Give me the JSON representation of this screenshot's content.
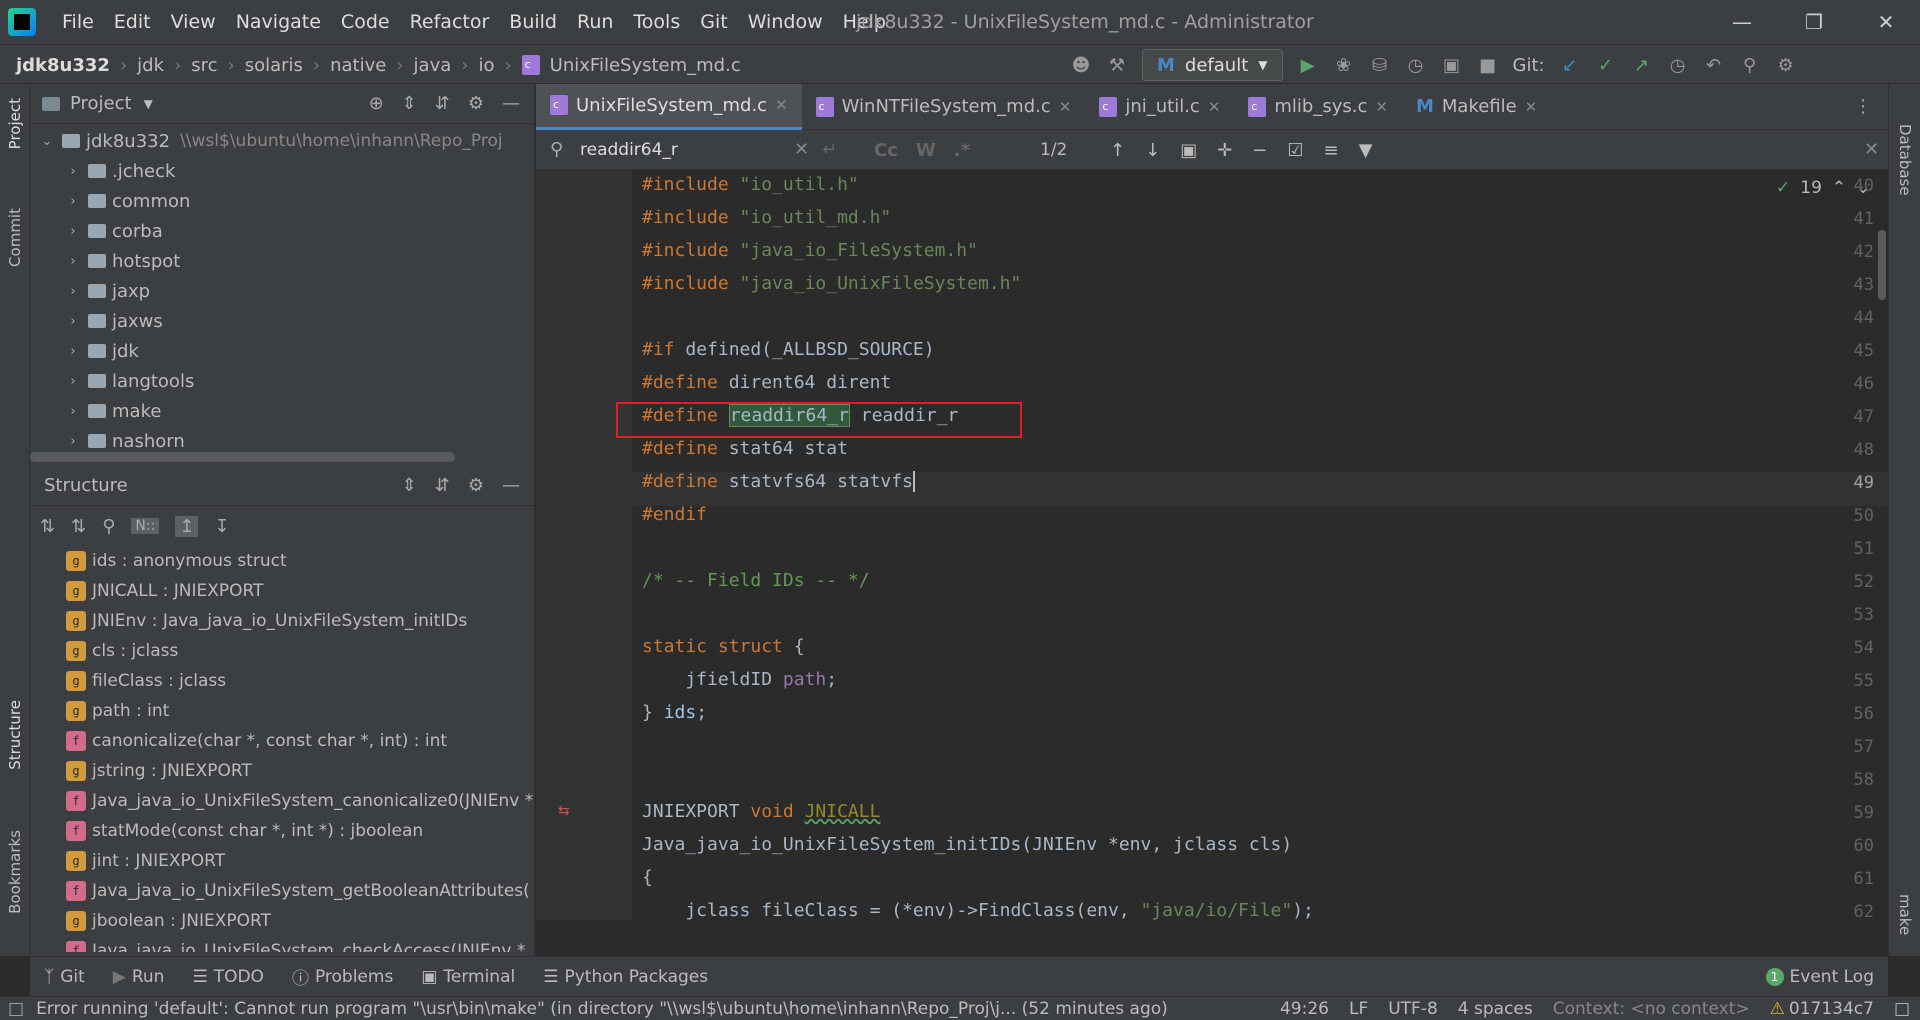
{
  "window": {
    "title": "jdk8u332 - UnixFileSystem_md.c - Administrator"
  },
  "menu": [
    "File",
    "Edit",
    "View",
    "Navigate",
    "Code",
    "Refactor",
    "Build",
    "Run",
    "Tools",
    "Git",
    "Window",
    "Help"
  ],
  "breadcrumb": [
    "jdk8u332",
    "jdk",
    "src",
    "solaris",
    "native",
    "java",
    "io",
    "UnixFileSystem_md.c"
  ],
  "toolbar": {
    "run_config": "default",
    "git_label": "Git:"
  },
  "side_tools": {
    "left": [
      "Project",
      "Commit",
      "Structure",
      "Bookmarks"
    ],
    "right": [
      "Database",
      "make"
    ]
  },
  "project_panel": {
    "title": "Project",
    "root": {
      "name": "jdk8u332",
      "path": "\\\\wsl$\\ubuntu\\home\\inhann\\Repo_Proj"
    },
    "items": [
      ".jcheck",
      "common",
      "corba",
      "hotspot",
      "jaxp",
      "jaxws",
      "jdk",
      "langtools",
      "make",
      "nashorn"
    ]
  },
  "structure_panel": {
    "title": "Structure",
    "items": [
      {
        "kind": "g",
        "label": "ids : anonymous struct"
      },
      {
        "kind": "g",
        "label": "JNICALL : JNIEXPORT"
      },
      {
        "kind": "g",
        "label": "JNIEnv : Java_java_io_UnixFileSystem_initIDs"
      },
      {
        "kind": "g",
        "label": "cls : jclass"
      },
      {
        "kind": "g",
        "label": "fileClass : jclass"
      },
      {
        "kind": "g",
        "label": "path : int"
      },
      {
        "kind": "f",
        "label": "canonicalize(char *, const char *, int) : int"
      },
      {
        "kind": "g",
        "label": "jstring : JNIEXPORT"
      },
      {
        "kind": "f",
        "label": "Java_java_io_UnixFileSystem_canonicalize0(JNIEnv *"
      },
      {
        "kind": "f",
        "label": "statMode(const char *, int *) : jboolean"
      },
      {
        "kind": "g",
        "label": "jint : JNIEXPORT"
      },
      {
        "kind": "f",
        "label": "Java_java_io_UnixFileSystem_getBooleanAttributes("
      },
      {
        "kind": "g",
        "label": "jboolean : JNIEXPORT"
      },
      {
        "kind": "f",
        "label": "Java_java_io_UnixFileSystem_checkAccess(JNIEnv *"
      }
    ]
  },
  "tabs": [
    {
      "label": "UnixFileSystem_md.c",
      "active": true
    },
    {
      "label": "WinNTFileSystem_md.c",
      "active": false
    },
    {
      "label": "jni_util.c",
      "active": false
    },
    {
      "label": "mlib_sys.c",
      "active": false
    },
    {
      "label": "Makefile",
      "active": false
    }
  ],
  "find": {
    "query": "readdir64_r",
    "match_count": "1/2",
    "options": [
      "Cc",
      "W",
      ".*"
    ]
  },
  "editor": {
    "inspection_count": "19",
    "lines": [
      {
        "n": "40",
        "text": "#include \"io_util.h\""
      },
      {
        "n": "41",
        "text": "#include \"io_util_md.h\""
      },
      {
        "n": "42",
        "text": "#include \"java_io_FileSystem.h\""
      },
      {
        "n": "43",
        "text": "#include \"java_io_UnixFileSystem.h\""
      },
      {
        "n": "44",
        "text": ""
      },
      {
        "n": "45",
        "text": "#if defined(_ALLBSD_SOURCE)"
      },
      {
        "n": "46",
        "text": "#define dirent64 dirent"
      },
      {
        "n": "47",
        "text": "#define readdir64_r readdir_r"
      },
      {
        "n": "48",
        "text": "#define stat64 stat"
      },
      {
        "n": "49",
        "text": "#define statvfs64 statvfs"
      },
      {
        "n": "50",
        "text": "#endif"
      },
      {
        "n": "51",
        "text": ""
      },
      {
        "n": "52",
        "text": "/* -- Field IDs -- */"
      },
      {
        "n": "53",
        "text": ""
      },
      {
        "n": "54",
        "text": "static struct {"
      },
      {
        "n": "55",
        "text": "    jfieldID path;"
      },
      {
        "n": "56",
        "text": "} ids;"
      },
      {
        "n": "57",
        "text": ""
      },
      {
        "n": "58",
        "text": ""
      },
      {
        "n": "59",
        "text": "JNIEXPORT void JNICALL"
      },
      {
        "n": "60",
        "text": "Java_java_io_UnixFileSystem_initIDs(JNIEnv *env, jclass cls)"
      },
      {
        "n": "61",
        "text": "{"
      },
      {
        "n": "62",
        "text": "    jclass fileClass = (*env)->FindClass(env, \"java/io/File\");"
      }
    ]
  },
  "bottom_tools": [
    "Git",
    "Run",
    "TODO",
    "Problems",
    "Terminal",
    "Python Packages"
  ],
  "event_log": {
    "count": "1",
    "label": "Event Log"
  },
  "status": {
    "message": "Error running 'default': Cannot run program \"\\usr\\bin\\make\" (in directory \"\\\\wsl$\\ubuntu\\home\\inhann\\Repo_Proj\\j... (52 minutes ago)",
    "position": "49:26",
    "line_sep": "LF",
    "encoding": "UTF-8",
    "indent": "4 spaces",
    "context": "Context: <no context>",
    "commit": "017134c7"
  }
}
